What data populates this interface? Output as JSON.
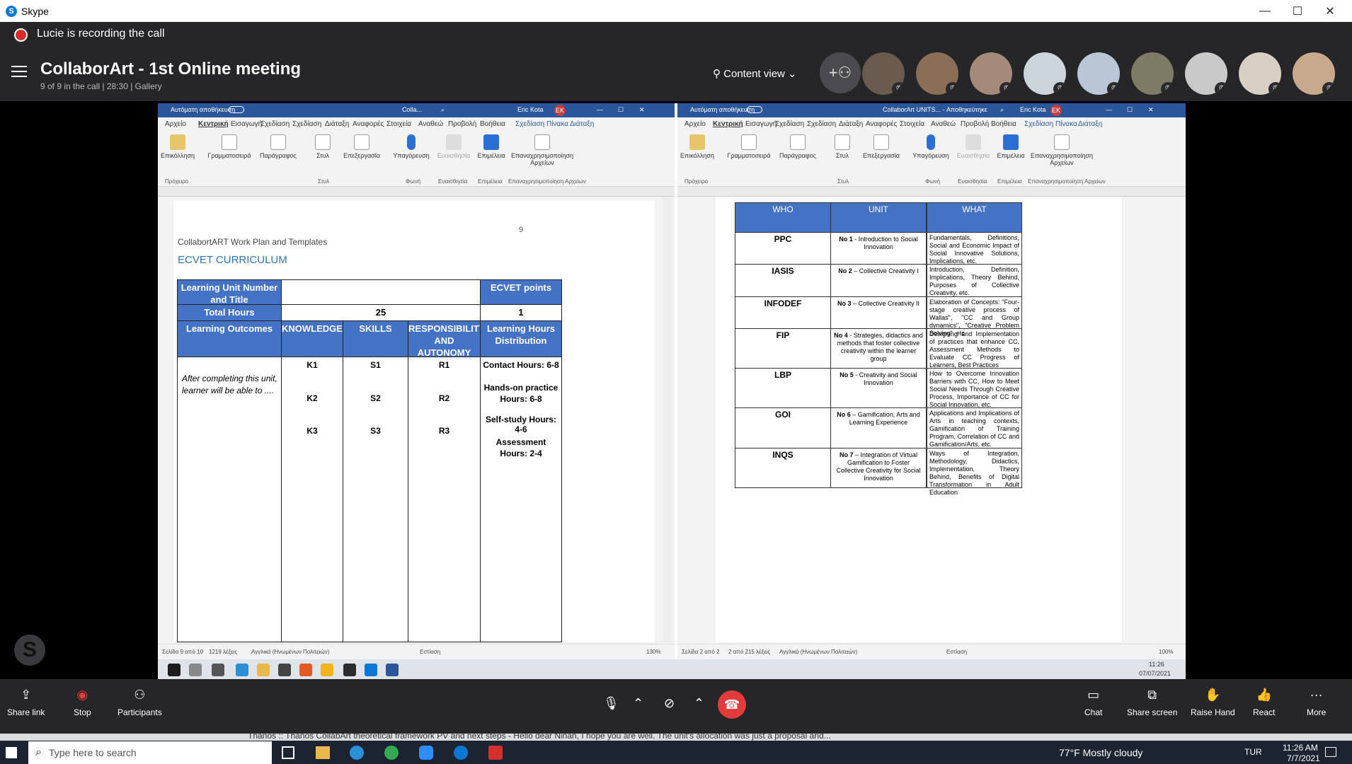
{
  "window": {
    "app_title": "Skype"
  },
  "recording": {
    "text": "Lucie is recording the call"
  },
  "call": {
    "title": "CollaborArt - 1st Online meeting",
    "subtitle": "9 of 9 in the call | 28:30 | Gallery",
    "content_view": "Content view"
  },
  "participants": [
    {
      "name": "p1",
      "color": "#6b5a4e"
    },
    {
      "name": "p2",
      "color": "#8a6e55"
    },
    {
      "name": "p3",
      "color": "#a58a7a"
    },
    {
      "name": "p4",
      "color": "#cdd5dc"
    },
    {
      "name": "p5",
      "color": "#b8c6d6"
    },
    {
      "name": "p6",
      "color": "#7d7a66"
    },
    {
      "name": "p7",
      "color": "#c9c9c9"
    },
    {
      "name": "p8",
      "color": "#d9d0c5"
    },
    {
      "name": "p9",
      "color": "#c9a98e"
    }
  ],
  "left_doc": {
    "autosave": "Αυτόματη αποθήκευση",
    "filename": "Colla...",
    "user": "Eric Kota",
    "initials": "EK",
    "menu": [
      "Αρχείο",
      "Κεντρική",
      "Εισαγωγή",
      "Σχεδίαση",
      "Σχεδίαση",
      "Διάταξη",
      "Αναφορές",
      "Στοιχεία",
      "Αναθεώ",
      "Προβολή",
      "Βοήθεια",
      "Σχεδίαση Πίνακα",
      "Διάταξη"
    ],
    "ribbon": [
      "Επικόλληση",
      "Γραμματοσειρά",
      "Παράγραφος",
      "Στυλ",
      "Επεξεργασία",
      "Υπαγόρευση",
      "Ευαισθησία",
      "Επιμέλεια",
      "Επαναχρησιμοποίηση Αρχείων"
    ],
    "groups": [
      "Πρόχειρο",
      "Στυλ",
      "Φωνή",
      "Ευαισθησία",
      "Επιμέλεια",
      "Επαναχρησιμοποίηση Αρχείων"
    ],
    "page_number": "9",
    "header_text": "CollabortART Work Plan and Templates",
    "heading": "ECVET CURRICULUM",
    "table": {
      "lu_title": "Learning Unit Number and Title",
      "ecvet_points": "ECVET points",
      "total_hours_label": "Total Hours",
      "total_hours": "25",
      "points": "1",
      "lo": "Learning Outcomes",
      "knowledge": "KNOWLEDGE",
      "skills": "SKILLS",
      "resp": "RESPONSIBILITY AND AUTONOMY",
      "lhd": "Learning Hours Distribution",
      "after": "After completing this unit, learner will be able to ....",
      "k": [
        "K1",
        "K2",
        "K3"
      ],
      "s": [
        "S1",
        "S2",
        "S3"
      ],
      "r": [
        "R1",
        "R2",
        "R3"
      ],
      "hours": [
        "Contact Hours: 6-8",
        "Hands-on practice Hours: 6-8",
        "Self-study Hours: 4-6",
        "Assessment Hours: 2-4"
      ]
    },
    "status": {
      "page": "Σελίδα 9 από 10",
      "words": "1219 λέξεις",
      "lang": "Αγγλικά (Ηνωμένων Πολιτειών)",
      "focus": "Εστίαση",
      "zoom": "130%"
    }
  },
  "right_doc": {
    "autosave": "Αυτόματη αποθήκευση",
    "filename": "CollaborArt UNITS... - Αποθηκεύτηκε",
    "user": "Eric Kota",
    "initials": "EK",
    "headers": [
      "WHO",
      "UNIT",
      "WHAT"
    ],
    "rows": [
      {
        "who": "PPC",
        "unit_no": "No 1",
        "unit": " - Introduction to Social Innovation",
        "what": "Fundamentals, Definitions, Social and Economic Impact of Social Innovative Solutions, Implications, etc."
      },
      {
        "who": "IASIS",
        "unit_no": "No 2",
        "unit": " – Collective Creativity I",
        "what": "Introduction, Definition, Implications, Theory Behind, Purposes of Collective Creativity, etc."
      },
      {
        "who": "INFODEF",
        "unit_no": "No 3",
        "unit": " – Collective Creativity II",
        "what": "Elaboration of Concepts: \"Four-stage creative process of Wallas\", \"CC and Group dynamics\", \"Creative Problem Solving\", etc."
      },
      {
        "who": "FIP",
        "unit_no": "No 4",
        "unit": " - Strategies, didactics and methods that foster collective creativity within the learner group",
        "what": "Designing and Implementation of practices that enhance CC, Assessment Methods to Evaluate CC Progress of Learners, Best Practices"
      },
      {
        "who": "LBP",
        "unit_no": "No 5",
        "unit": " - Creativity and Social Innovation",
        "what": "How to Overcome Innovation Barriers with CC, How to Meet Social Needs Through Creative Process, Importance of CC for Social Innovation, etc."
      },
      {
        "who": "GOI",
        "unit_no": "No 6",
        "unit": " – Gamification, Arts and Learning Experience",
        "what": "Applications and Implications of Arts in teaching contexts, Gamification of Training Program, Correlation of CC and Gamification/Arts, etc."
      },
      {
        "who": "INQS",
        "unit_no": "No 7",
        "unit": " – Integration of Virtual Gamification to Foster Collective Creativity for Social Innovation",
        "what": "Ways of Integration, Methodology, Didactics, Implementation, Theory Behind, Benefits of Digital Transformation in Adult Education"
      }
    ],
    "status": {
      "page": "Σελίδα 2 από 2",
      "words": "2 από 215 λέξεις",
      "lang": "Αγγλικά (Ηνωμένων Πολιτειών)",
      "focus": "Εστίαση",
      "zoom": "100%"
    },
    "clock": "11:26",
    "date": "07/07/2021"
  },
  "controls": {
    "share_link": "Share link",
    "stop": "Stop",
    "participants": "Participants",
    "chat": "Chat",
    "share_screen": "Share screen",
    "raise_hand": "Raise Hand",
    "react": "React",
    "more": "More"
  },
  "peek": {
    "text": "Thanos :: Thanos     CollabArt theoretical framework PV and next steps - Hello dear Ninan, I hope you are well. The unit's allocation was just a proposal and..."
  },
  "taskbar": {
    "search_placeholder": "Type here to search",
    "weather": "77°F  Mostly cloudy",
    "lang": "TUR",
    "time": "11:26 AM",
    "date": "7/7/2021"
  }
}
